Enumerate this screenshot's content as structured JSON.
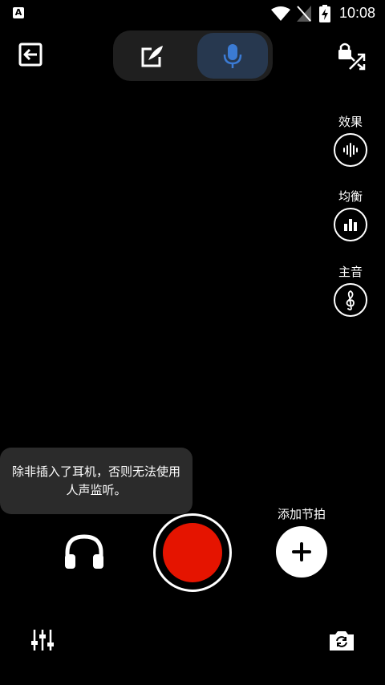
{
  "status_bar": {
    "time": "10:08",
    "badge": "A"
  },
  "side_controls": {
    "effects_label": "效果",
    "equalizer_label": "均衡",
    "key_label": "主音"
  },
  "tooltip": {
    "text": "除非插入了耳机，否则无法使用人声监听。"
  },
  "add_beat": {
    "label": "添加节拍"
  },
  "colors": {
    "record": "#e51400",
    "accent": "#3b7bd4",
    "toggle_active": "#27384f"
  }
}
